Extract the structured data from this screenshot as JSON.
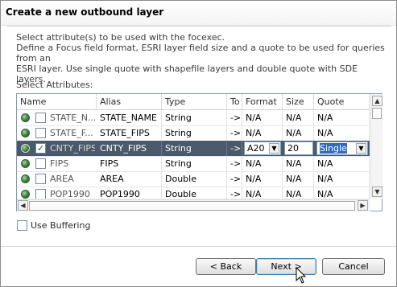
{
  "dialog": {
    "title": "Create a new outbound layer",
    "description_lines": [
      "Select attribute(s) to be used with the focexec.",
      "Define a Focus field format, ESRI layer field size and a quote to be used for queries from an",
      "ESRI layer. Use single quote with shapefile layers and double quote with SDE layers."
    ],
    "attributes_label": "Select Attributes:"
  },
  "grid": {
    "headers": [
      "Name",
      "Alias",
      "Type",
      "To",
      "Format",
      "Size",
      "Quote"
    ],
    "rows": [
      {
        "checked": false,
        "name": "STATE_N...",
        "alias": "STATE_NAME",
        "type": "String",
        "to": "->",
        "format": "N/A",
        "size": "N/A",
        "quote": "N/A"
      },
      {
        "checked": false,
        "name": "STATE_F...",
        "alias": "STATE_FIPS",
        "type": "String",
        "to": "->",
        "format": "N/A",
        "size": "N/A",
        "quote": "N/A"
      },
      {
        "checked": true,
        "name": "CNTY_FIPS",
        "alias": "CNTY_FIPS",
        "type": "String",
        "to": "->",
        "format": "A20",
        "size": "20",
        "quote": "Single"
      },
      {
        "checked": false,
        "name": "FIPS",
        "alias": "FIPS",
        "type": "String",
        "to": "->",
        "format": "N/A",
        "size": "N/A",
        "quote": "N/A"
      },
      {
        "checked": false,
        "name": "AREA",
        "alias": "AREA",
        "type": "Double",
        "to": "->",
        "format": "N/A",
        "size": "N/A",
        "quote": "N/A"
      },
      {
        "checked": false,
        "name": "POP1990",
        "alias": "POP1990",
        "type": "Double",
        "to": "->",
        "format": "N/A",
        "size": "N/A",
        "quote": "N/A"
      }
    ],
    "check_mark": "✓"
  },
  "options": {
    "use_buffering_label": "Use Buffering",
    "use_buffering_checked": false
  },
  "buttons": {
    "back": "< Back",
    "next": "Next >",
    "cancel": "Cancel"
  },
  "colors": {
    "selected_row": "#4a5a6a",
    "selection_highlight": "#316ac5",
    "globe_green": "#2f7a2f"
  },
  "icons": {
    "row_icon": "green-globe-icon",
    "dropdown": "chevron-down-icon",
    "scroll_up": "arrow-up-icon",
    "scroll_down": "arrow-down-icon",
    "scroll_left": "arrow-left-icon",
    "scroll_right": "arrow-right-icon",
    "cursor": "mouse-pointer-icon"
  }
}
